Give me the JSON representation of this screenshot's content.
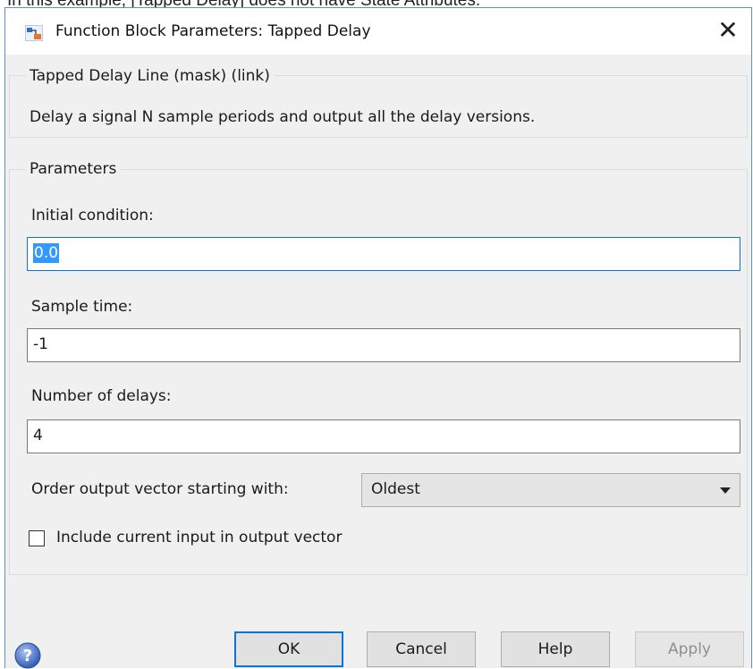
{
  "caption_text": "In this example, [Tapped Delay] does not have State Attributes.",
  "window": {
    "title": "Function Block Parameters: Tapped Delay",
    "close_glyph": "✕"
  },
  "description_group": {
    "legend": "Tapped Delay Line (mask) (link)",
    "text": "Delay a signal N sample periods and output all the delay versions."
  },
  "parameters_group": {
    "legend": "Parameters",
    "initial_condition": {
      "label": "Initial condition:",
      "value": "0.0"
    },
    "sample_time": {
      "label": "Sample time:",
      "value": "-1"
    },
    "number_of_delays": {
      "label": "Number of delays:",
      "value": "4"
    },
    "order_output": {
      "label": "Order output vector starting with:",
      "selected": "Oldest"
    },
    "include_current": {
      "label": "Include current input in output vector",
      "checked": false
    }
  },
  "buttons": {
    "ok": "OK",
    "cancel": "Cancel",
    "help": "Help",
    "apply": "Apply"
  },
  "icons": {
    "app": "simulink-icon",
    "help": "help-question-icon"
  },
  "colors": {
    "accent": "#0a74da",
    "selection": "#3399ff",
    "dialog_bg": "#f0f0f0"
  }
}
